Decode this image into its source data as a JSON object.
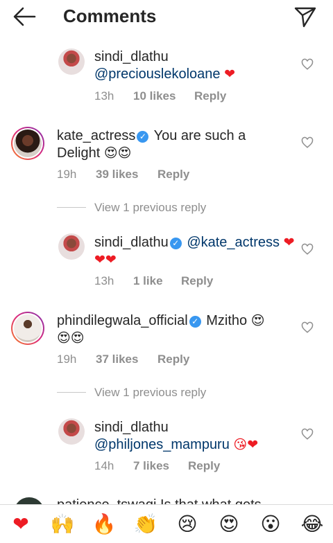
{
  "header": {
    "title": "Comments",
    "back_icon": "arrow-left-icon",
    "send_icon": "paper-plane-icon"
  },
  "comments": [
    {
      "username": "sindi_dlathu",
      "verified": false,
      "mention": "@preciouslekoloane",
      "emojis": "❤",
      "time": "13h",
      "likes": "10 likes",
      "reply": "Reply"
    },
    {
      "username": "kate_actress",
      "verified": true,
      "text": "You are such a Delight",
      "emojis": "😍😍",
      "time": "19h",
      "likes": "39 likes",
      "reply": "Reply",
      "view_replies": "View 1 previous reply",
      "replies": [
        {
          "username": "sindi_dlathu",
          "verified": true,
          "mention": "@kate_actress",
          "emojis": "❤❤❤",
          "time": "13h",
          "likes": "1 like",
          "reply": "Reply"
        }
      ]
    },
    {
      "username": "phindilegwala_official",
      "verified": true,
      "text": "Mzitho",
      "emojis": "😍😍😍",
      "time": "19h",
      "likes": "37 likes",
      "reply": "Reply",
      "view_replies": "View 1 previous reply",
      "replies": [
        {
          "username": "sindi_dlathu",
          "verified": false,
          "mention": "@philjones_mampuru",
          "emojis": "😘❤",
          "time": "14h",
          "likes": "7 likes",
          "reply": "Reply"
        }
      ]
    }
  ],
  "partial_comment": "patience_tswagi Is that what gets",
  "emoji_bar": [
    "❤",
    "🙌",
    "🔥",
    "👏",
    "😢",
    "😍",
    "😮",
    "😂"
  ],
  "colors": {
    "accent_blue": "#3897f0",
    "mention": "#00376b",
    "heart": "#ed1c24",
    "meta_gray": "#8e8e8e"
  }
}
